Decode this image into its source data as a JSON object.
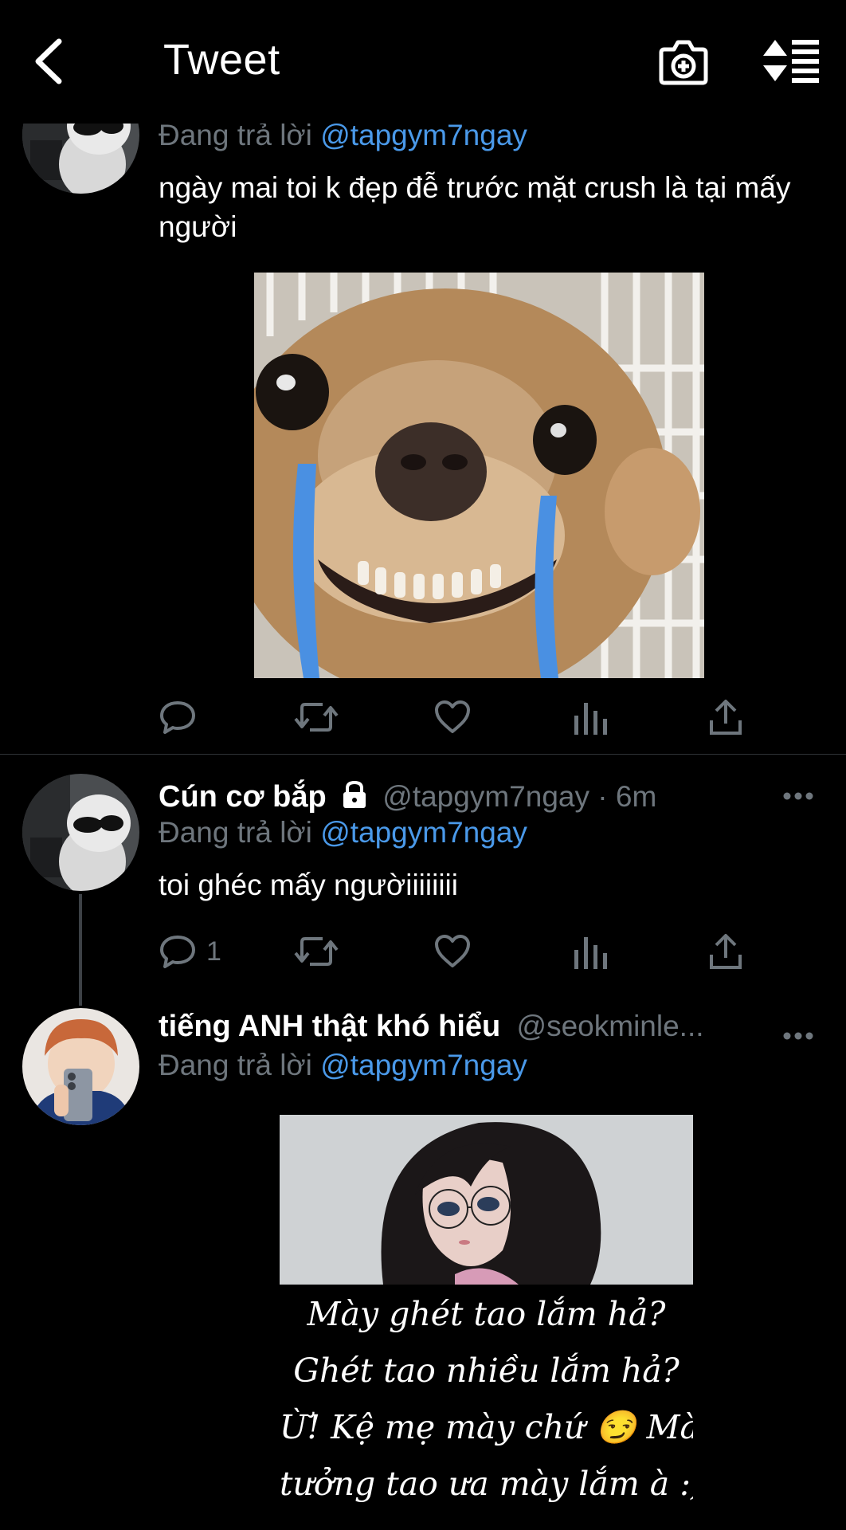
{
  "header": {
    "title": "Tweet",
    "back_icon": "chevron-left-icon",
    "camera_icon": "camera-plus-icon",
    "sort_icon": "sort-replies-icon"
  },
  "colors": {
    "background": "#000000",
    "text": "#ffffff",
    "secondary": "#6e767d",
    "mention": "#4a99e9",
    "tear_blue": "#4a90e2"
  },
  "tweets": [
    {
      "reply_prefix": "Đang trả lời",
      "reply_to": "@tapgym7ngay",
      "text": "ngày mai toi k đẹp đễ trước mặt crush là tại mấy người",
      "media": "crying-chihuahua-meme",
      "actions": {
        "reply_count": "",
        "retweet_count": "",
        "like_count": ""
      }
    },
    {
      "name": "Cún cơ bắp",
      "lock_icon": "lock-icon",
      "handle": "@tapgym7ngay",
      "time": "· 6m",
      "reply_prefix": "Đang trả lời",
      "reply_to": "@tapgym7ngay",
      "text": "toi ghéc mấy ngườiiiiiiii",
      "actions": {
        "reply_count": "1",
        "retweet_count": "",
        "like_count": ""
      }
    },
    {
      "name": "tiếng ANH thật khó hiểu",
      "handle": "@seokminle...",
      "reply_prefix": "Đang trả lời",
      "reply_to": "@tapgym7ngay",
      "media": "anime-girl-meme",
      "meme_lines": [
        "Mày ghét tao lắm hả?",
        "Ghét tao nhiều lắm hả?",
        "Ừ!  Kệ mẹ mày chứ 😏 Mày",
        "tưởng tao ưa mày lắm à :)))"
      ]
    }
  ]
}
